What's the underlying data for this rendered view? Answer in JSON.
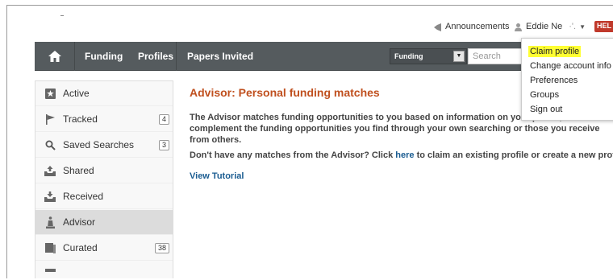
{
  "header": {
    "announcements_label": "Announcements",
    "user_name": "Eddie Ne",
    "user_name_suffix": "·'.",
    "user_caret": "▼",
    "help_badge": "HEL"
  },
  "nav": {
    "home_icon": "home-icon",
    "items": [
      {
        "label": "Funding"
      },
      {
        "label": "Profiles"
      },
      {
        "label": "Papers Invited"
      }
    ],
    "search_scope": "Funding",
    "search_placeholder": "Search"
  },
  "user_menu": {
    "items": [
      {
        "label": "Claim profile",
        "highlighted": true
      },
      {
        "label": "Change account info"
      },
      {
        "label": "Preferences"
      },
      {
        "label": "Groups"
      },
      {
        "label": "Sign out"
      }
    ]
  },
  "sidebar": {
    "items": [
      {
        "label": "Active",
        "icon": "star-icon"
      },
      {
        "label": "Tracked",
        "icon": "flag-icon",
        "count": "4"
      },
      {
        "label": "Saved Searches",
        "icon": "search-icon",
        "count": "3"
      },
      {
        "label": "Shared",
        "icon": "tray-up-icon"
      },
      {
        "label": "Received",
        "icon": "tray-down-icon"
      },
      {
        "label": "Advisor",
        "icon": "advisor-icon",
        "active": true
      },
      {
        "label": "Curated",
        "icon": "book-icon",
        "count": "38"
      }
    ]
  },
  "main": {
    "title": "Advisor: Personal funding matches",
    "para1": "The Advisor matches funding opportunities to you based on information on your profile, to complement the funding opportunities you find through your own searching or those you receive from others.",
    "para2_before": "Don't have any matches from the Advisor? Click ",
    "para2_link": "here",
    "para2_after": " to claim an existing profile or create a new profile.",
    "tutorial_link": "View Tutorial"
  },
  "colors": {
    "title": "#c0501f",
    "link": "#1a5c91",
    "navbar": "#555b5e",
    "highlight": "#ffff33"
  }
}
